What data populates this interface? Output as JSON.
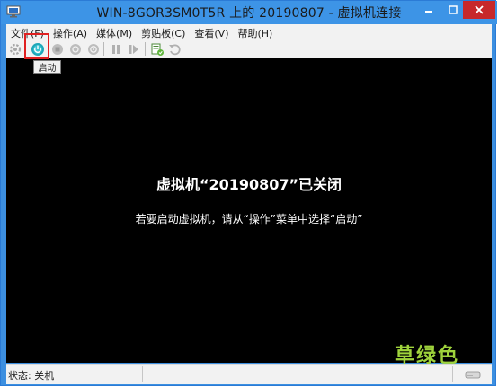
{
  "window": {
    "title": "WIN-8GOR3SM0T5R 上的 20190807 - 虚拟机连接",
    "accent": "#3d94e6"
  },
  "menu": {
    "items": [
      {
        "label": "文件(F)"
      },
      {
        "label": "操作(A)"
      },
      {
        "label": "媒体(M)"
      },
      {
        "label": "剪贴板(C)"
      },
      {
        "label": "查看(V)"
      },
      {
        "label": "帮助(H)"
      }
    ]
  },
  "toolbar": {
    "tooltip": "启动",
    "buttons": [
      {
        "icon": "ctrl-alt-del-icon"
      },
      {
        "icon": "power-start-icon",
        "highlighted": true
      },
      {
        "icon": "turn-off-icon"
      },
      {
        "icon": "shutdown-icon"
      },
      {
        "icon": "save-state-icon"
      },
      {
        "icon": "pause-icon"
      },
      {
        "icon": "resume-icon"
      },
      {
        "icon": "checkpoint-icon"
      },
      {
        "icon": "revert-icon"
      }
    ]
  },
  "screen": {
    "title": "虚拟机“20190807”已关闭",
    "message": "若要启动虚拟机，请从“操作”菜单中选择“启动”",
    "watermark": "草绿色"
  },
  "status": {
    "text": "状态: 关机"
  }
}
